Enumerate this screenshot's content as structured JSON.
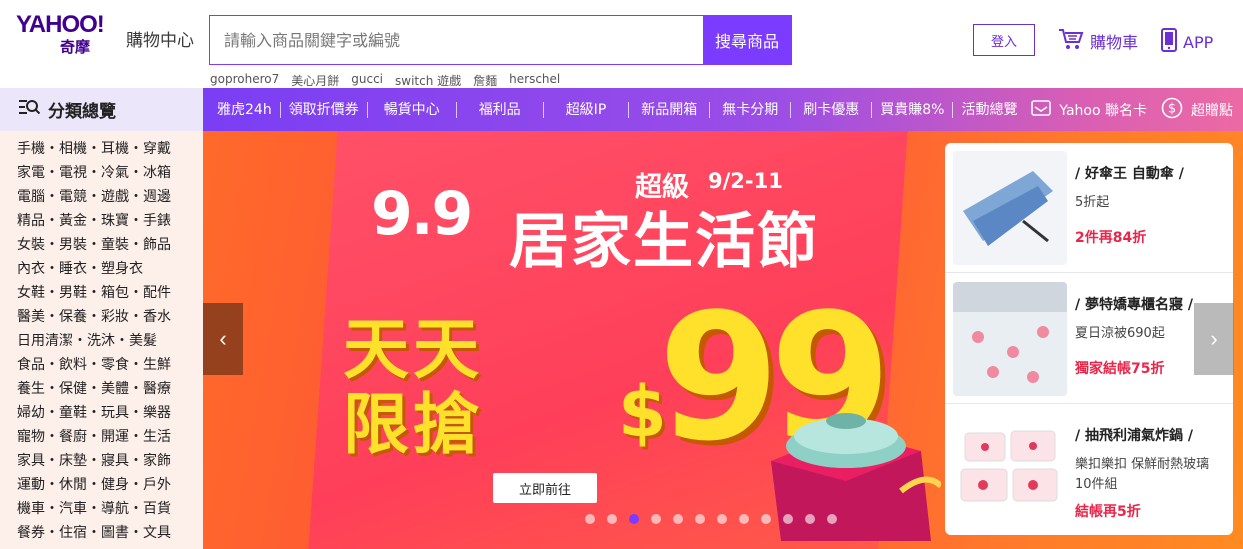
{
  "header": {
    "logo_main": "YAHOO!",
    "logo_sub": "奇摩",
    "store_name": "購物中心",
    "search_placeholder": "請輸入商品關鍵字或編號",
    "search_button": "搜尋商品",
    "hot_terms": [
      "goprohero7",
      "美心月餅",
      "gucci",
      "switch 遊戲",
      "詹麵",
      "herschel"
    ],
    "login": "登入",
    "cart": "購物車",
    "app": "APP",
    "accent_color": "#7b3cff"
  },
  "nav": {
    "category_title": "分類總覽",
    "links": [
      "雅虎24h",
      "領取折價券",
      "暢貨中心",
      "福利品",
      "超級IP",
      "新品開箱",
      "無卡分期",
      "刷卡優惠",
      "買貴賺8%",
      "活動總覽"
    ],
    "card_label": "Yahoo 聯名卡",
    "points_label": "超贈點"
  },
  "sidebar": {
    "items": [
      "手機・相機・耳機・穿戴",
      "家電・電視・冷氣・冰箱",
      "電腦・電競・遊戲・週邊",
      "精品・黃金・珠寶・手錶",
      "女裝・男裝・童裝・飾品",
      "內衣・睡衣・塑身衣",
      "女鞋・男鞋・箱包・配件",
      "醫美・保養・彩妝・香水",
      "日用清潔・洗沐・美髮",
      "食品・飲料・零食・生鮮",
      "養生・保健・美體・醫療",
      "婦幼・童鞋・玩具・樂器",
      "寵物・餐廚・開運・生活",
      "家具・床墊・寢具・家飾",
      "運動・休閒・健身・戶外",
      "機車・汽車・導航・百貨",
      "餐券・住宿・圖書・文具"
    ]
  },
  "banner": {
    "small_99": "9.9",
    "super": "超級",
    "date": "9/2-11",
    "title": "居家生活節",
    "line1": "天天",
    "line2": "限搶",
    "dollar": "$",
    "price": "99",
    "cta": "立即前往",
    "dot_count": 12,
    "active_dot": 2
  },
  "cards": [
    {
      "title": "/ 好傘王 自動傘 /",
      "desc": "5折起",
      "promo": "2件再84折"
    },
    {
      "title": "/ 夢特嬌專櫃名寢 /",
      "desc": "夏日涼被690起",
      "promo": "獨家結帳75折"
    },
    {
      "title": "/ 抽飛利浦氣炸鍋 /",
      "desc": "樂扣樂扣 保鮮耐熱玻璃10件組",
      "promo": "結帳再5折"
    }
  ]
}
